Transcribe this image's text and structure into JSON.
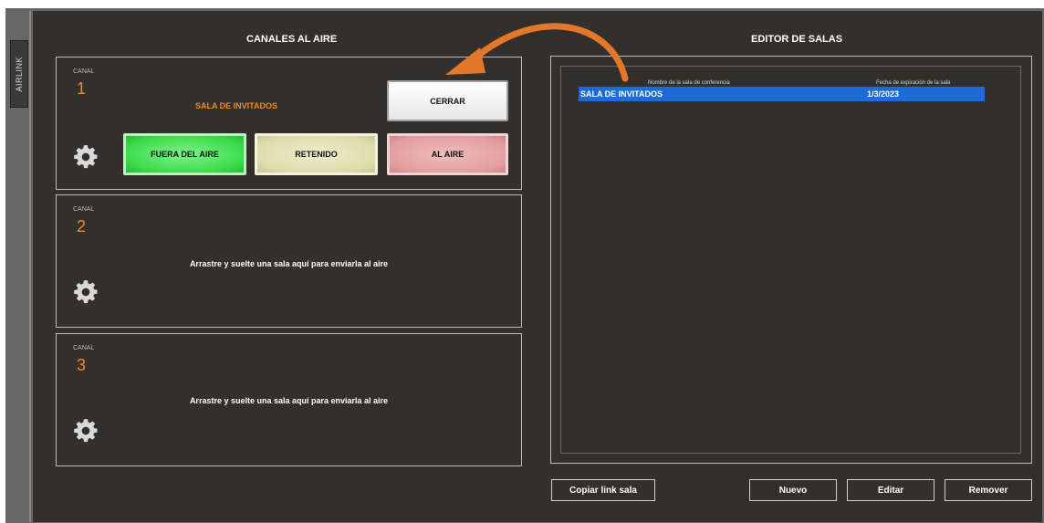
{
  "sidebar": {
    "tab_label": "AIRLINK"
  },
  "channels_panel": {
    "title": "CANALES AL AIRE",
    "channels": [
      {
        "label": "CANAL",
        "number": "1",
        "room_name": "SALA DE INVITADOS",
        "buttons": {
          "close": "CERRAR",
          "off_air": "FUERA DEL AIRE",
          "hold": "RETENIDO",
          "on_air": "AL AIRE"
        }
      },
      {
        "label": "CANAL",
        "number": "2",
        "drop_hint": "Arrastre y suelte una sala aquí para enviarla al aire"
      },
      {
        "label": "CANAL",
        "number": "3",
        "drop_hint": "Arrastre y suelte una sala aquí para enviarla al aire"
      }
    ]
  },
  "room_editor": {
    "title": "EDITOR DE SALAS",
    "columns": [
      "Nombre de la sala de conferencia",
      "Fecha de expiración de la sala"
    ],
    "rows": [
      {
        "name": "SALA DE INVITADOS",
        "expiration": "1/3/2023",
        "selected": true
      }
    ],
    "buttons": {
      "copy_link": "Copiar link sala",
      "new": "Nuevo",
      "edit": "Editar",
      "remove": "Remover"
    }
  },
  "colors": {
    "background": "#322f2c",
    "accent_orange": "#f08a24",
    "selection_blue": "#1c6bd6",
    "off_air_green": "#3fdc4e",
    "hold_yellow": "#dcdcac",
    "on_air_red": "#e39e9e"
  },
  "icons": {
    "settings": "gear-icon",
    "annotation": "curved-arrow-icon"
  }
}
